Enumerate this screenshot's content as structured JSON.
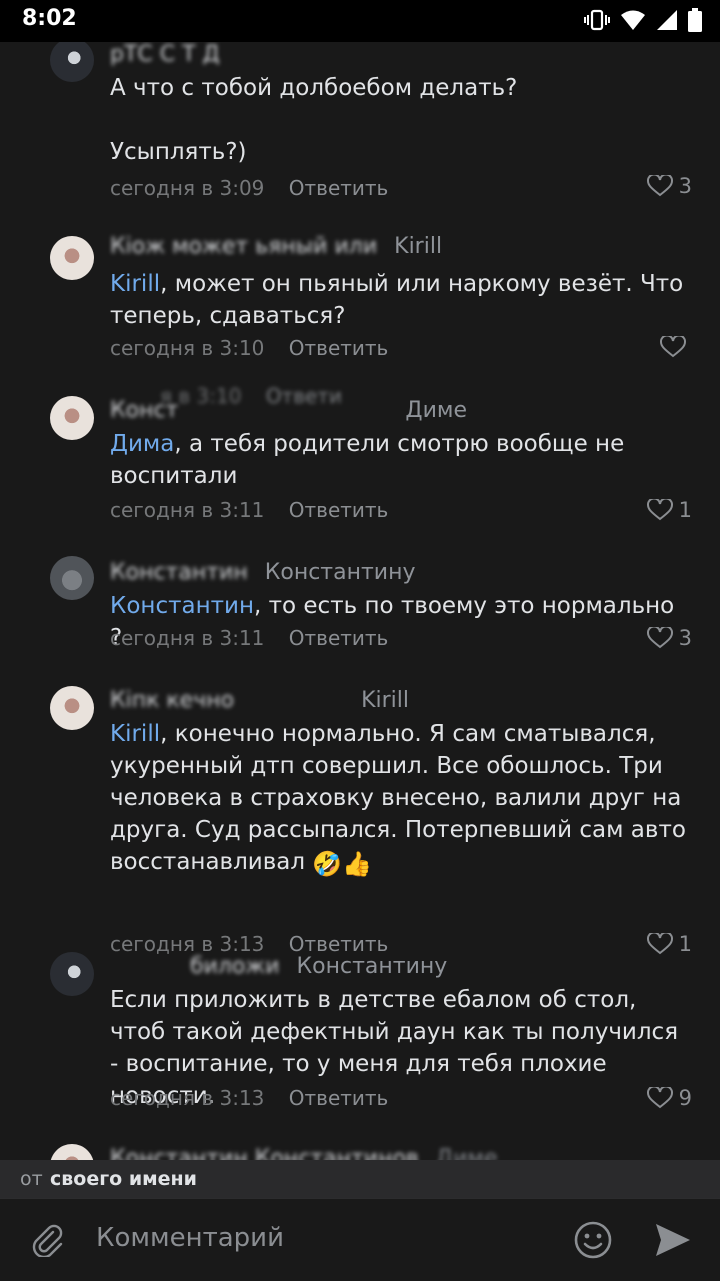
{
  "status": {
    "time": "8:02"
  },
  "comments": [
    {
      "author": "рТС С Т Д",
      "text_lines": [
        "А что с тобой долбоебом делать?",
        "",
        "Усыплять?)"
      ],
      "time": "сегодня в 3:09",
      "reply_label": "Ответить",
      "likes": "3"
    },
    {
      "author": "Кiож может ьяный или",
      "reply_to": "Kirill",
      "mention": "Kirill",
      "text": ", может он пьяный или наркому везёт. Что теперь, сдаваться?",
      "time": "сегодня в 3:10",
      "reply_label": "Ответить",
      "likes": ""
    },
    {
      "overlap_time": "я в 3:10",
      "overlap_reply": "Ответи",
      "author": "Конст",
      "reply_to": "Диме",
      "mention": "Дима",
      "text": ", а тебя родители смотрю вообще не воспитали",
      "time": "сегодня в 3:11",
      "reply_label": "Ответить",
      "likes": "1"
    },
    {
      "author": "Константин",
      "reply_to": "Константину",
      "mention": "Константин",
      "text": ", то есть по твоему это нормально ?",
      "time": "сегодня в 3:11",
      "reply_label": "Ответить",
      "likes": "3"
    },
    {
      "author": "Кiпк кечно",
      "reply_to": "Kirill",
      "mention": "Kirill",
      "text": ", конечно нормально. Я сам сматывался, укуренный дтп совершил. Все обошлось. Три человека в страховку внесено, валили друг на друга. Суд рассыпался. Потерпевший сам авто восстанавливал",
      "emojis": "🤣👍",
      "time": "сегодня в 3:13",
      "reply_label": "Ответить",
      "likes": "1"
    },
    {
      "author": "биложи",
      "reply_to": "Константину",
      "text": "Если приложить в детстве ебалом об стол, чтоб такой дефектный даун как ты получился - воспитание, то у меня для тебя плохие новости.",
      "time": "сегодня в 3:13",
      "reply_label": "Ответить",
      "likes": "9"
    },
    {
      "author": "Константин Константинов",
      "reply_to": "Диме"
    }
  ],
  "from_bar": {
    "prefix": "от",
    "name": "своего имени"
  },
  "composer": {
    "placeholder": "Комментарий"
  },
  "icons": {
    "vibrate": "vibrate-icon",
    "wifi": "wifi-icon",
    "signal": "signal-icon",
    "battery": "battery-icon",
    "heart": "heart-icon",
    "attach": "paperclip-icon",
    "emoji": "smiley-icon",
    "send": "send-icon"
  }
}
